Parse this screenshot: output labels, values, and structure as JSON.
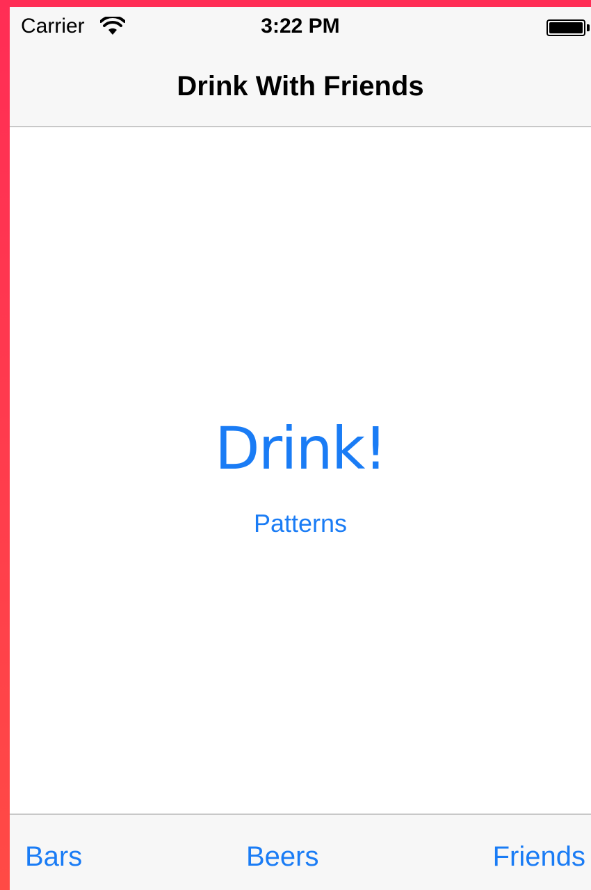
{
  "status_bar": {
    "carrier": "Carrier",
    "time": "3:22 PM",
    "wifi_icon": "wifi-icon",
    "battery_icon": "battery-full-icon"
  },
  "nav_bar": {
    "title": "Drink With Friends"
  },
  "main": {
    "drink_label": "Drink!",
    "patterns_label": "Patterns"
  },
  "toolbar": {
    "bars_label": "Bars",
    "beers_label": "Beers",
    "friends_label": "Friends"
  },
  "colors": {
    "accent": "#1a7cf5",
    "bar_background": "#f7f7f7",
    "frame": "#ff2d55"
  }
}
